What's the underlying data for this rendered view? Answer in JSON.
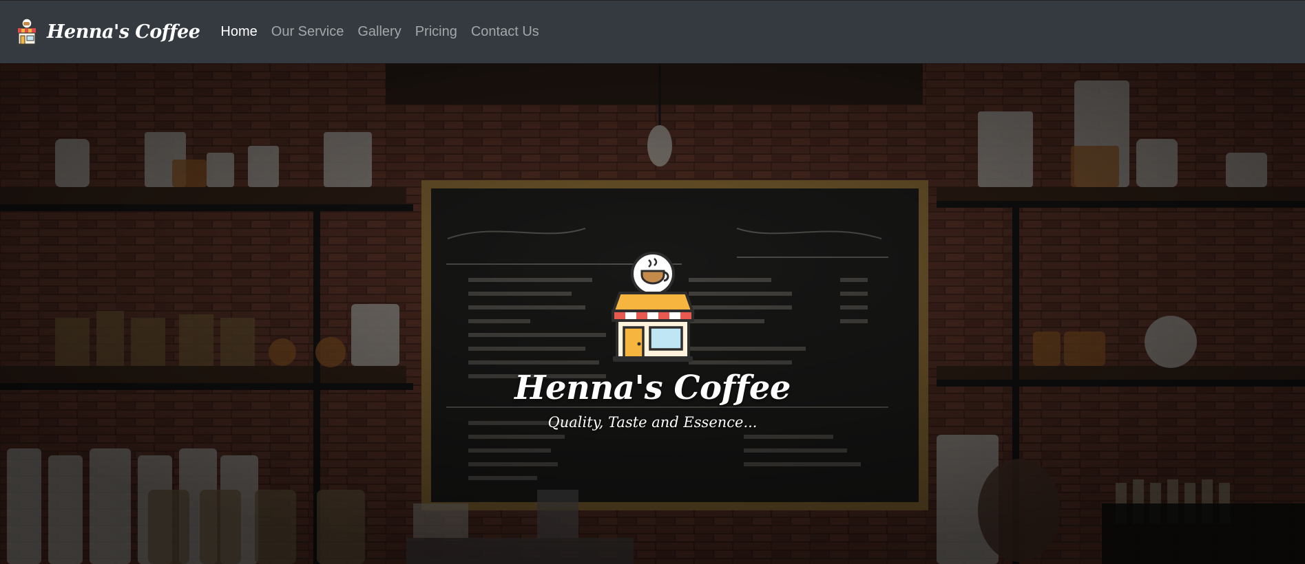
{
  "brand": {
    "name": "Henna's Coffee",
    "icon": "coffee-shop-icon"
  },
  "nav": {
    "items": [
      {
        "label": "Home",
        "active": true
      },
      {
        "label": "Our Service",
        "active": false
      },
      {
        "label": "Gallery",
        "active": false
      },
      {
        "label": "Pricing",
        "active": false
      },
      {
        "label": "Contact Us",
        "active": false
      }
    ]
  },
  "hero": {
    "title": "Henna's Coffee",
    "tagline": "Quality, Taste and Essence...",
    "logo_icon": "coffee-shop-icon",
    "background": "coffee-bar-photo"
  },
  "colors": {
    "navbar": "#343a40",
    "nav_active": "#ffffff",
    "nav_inactive": "#9a9da0"
  }
}
